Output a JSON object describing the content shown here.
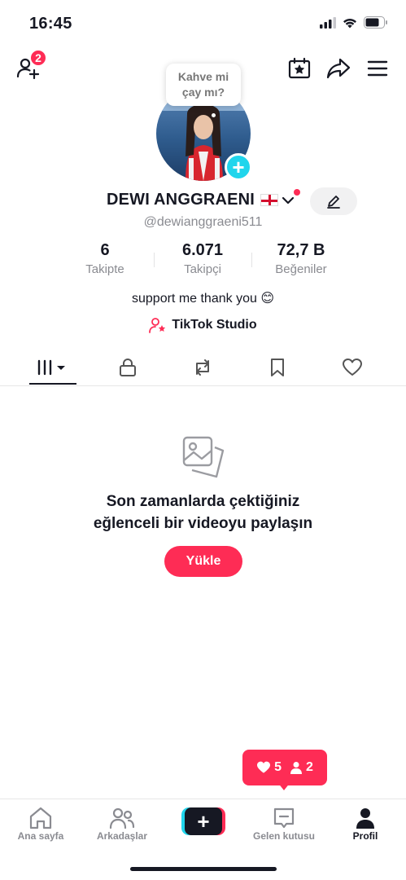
{
  "status_bar": {
    "time": "16:45"
  },
  "header": {
    "notification_count": "2"
  },
  "bubble": {
    "line1": "Kahve mi",
    "line2": "çay mı?"
  },
  "profile": {
    "display_name": "DEWI ANGGRAENI",
    "username": "@dewianggraeni511",
    "bio": "support me  thank you 😊",
    "studio_label": "TikTok Studio"
  },
  "stats": [
    {
      "value": "6",
      "label": "Takipte"
    },
    {
      "value": "6.071",
      "label": "Takipçi"
    },
    {
      "value": "72,7 B",
      "label": "Beğeniler"
    }
  ],
  "empty_state": {
    "line1": "Son zamanlarda çektiğiniz",
    "line2": "eğlenceli bir videoyu paylaşın",
    "button": "Yükle"
  },
  "activity": {
    "likes": "5",
    "followers": "2"
  },
  "nav": [
    {
      "label": "Ana sayfa",
      "icon": "home-icon"
    },
    {
      "label": "Arkadaşlar",
      "icon": "friends-icon"
    },
    {
      "label": "",
      "icon": "create-icon"
    },
    {
      "label": "Gelen kutusu",
      "icon": "inbox-icon"
    },
    {
      "label": "Profil",
      "icon": "profile-icon"
    }
  ],
  "colors": {
    "accent": "#fe2c55",
    "cyan": "#20d5ec",
    "text": "#161823",
    "muted": "#8a8b91"
  }
}
